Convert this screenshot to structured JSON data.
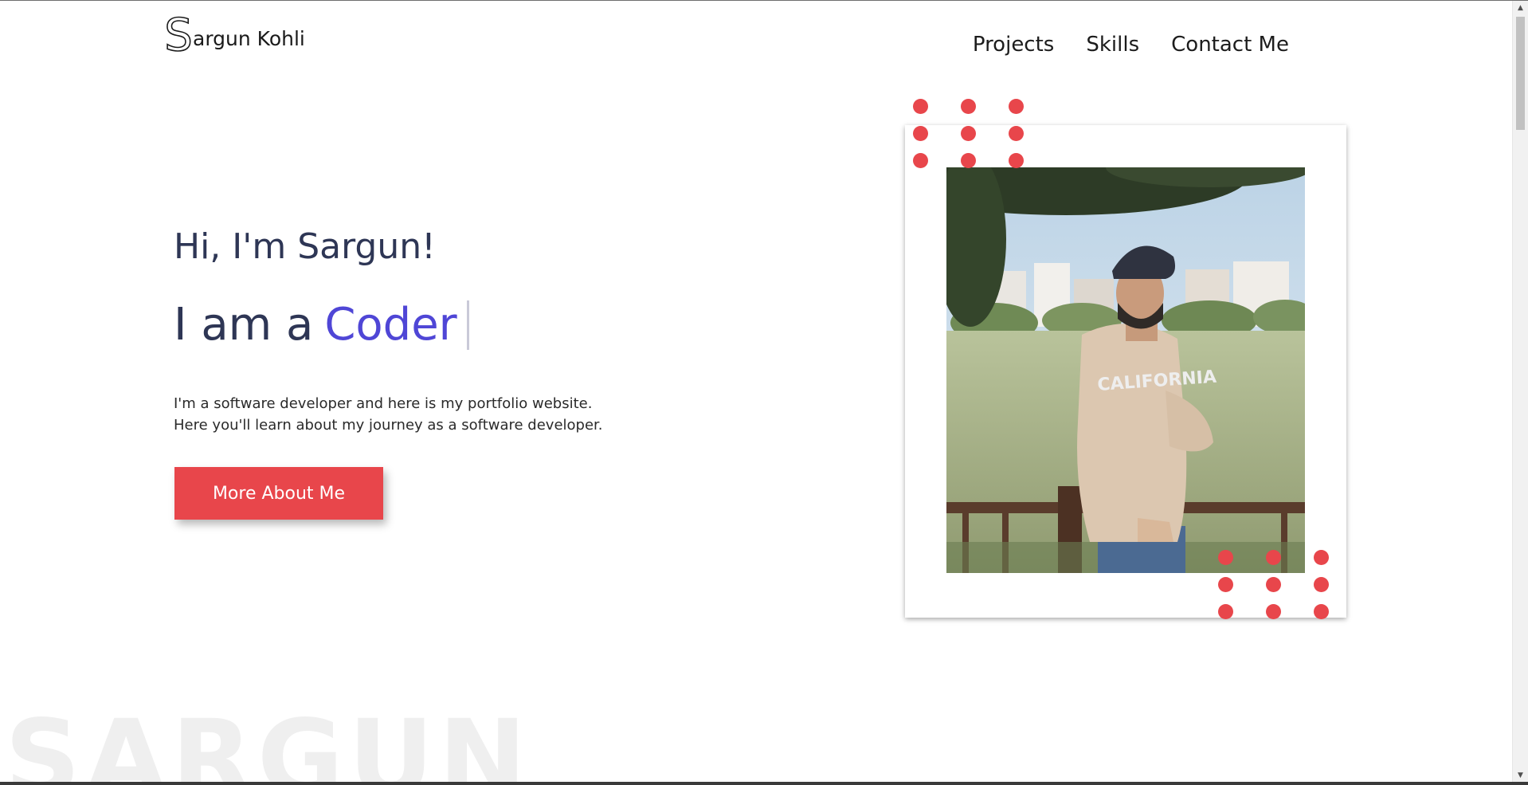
{
  "brand": {
    "logo_letter": "S",
    "name": "argun Kohli"
  },
  "nav": {
    "items": [
      {
        "label": "Projects"
      },
      {
        "label": "Skills"
      },
      {
        "label": "Contact Me"
      }
    ]
  },
  "hero": {
    "greeting": "Hi, I'm Sargun!",
    "headline_prefix": "I am a",
    "headline_role": "Coder",
    "bio_line_1": "I'm a software developer and here is my portfolio website.",
    "bio_line_2": "Here you'll learn about my journey as a software developer.",
    "cta_label": "More About Me"
  },
  "watermark": "SARGUN",
  "colors": {
    "accent_red": "#e8464b",
    "role_purple": "#4f46d6",
    "heading_navy": "#2e3655"
  },
  "icons": {
    "logo": "outlined-s-logo-icon",
    "photo": "profile-photo",
    "dots": "decorative-dot-grid"
  }
}
